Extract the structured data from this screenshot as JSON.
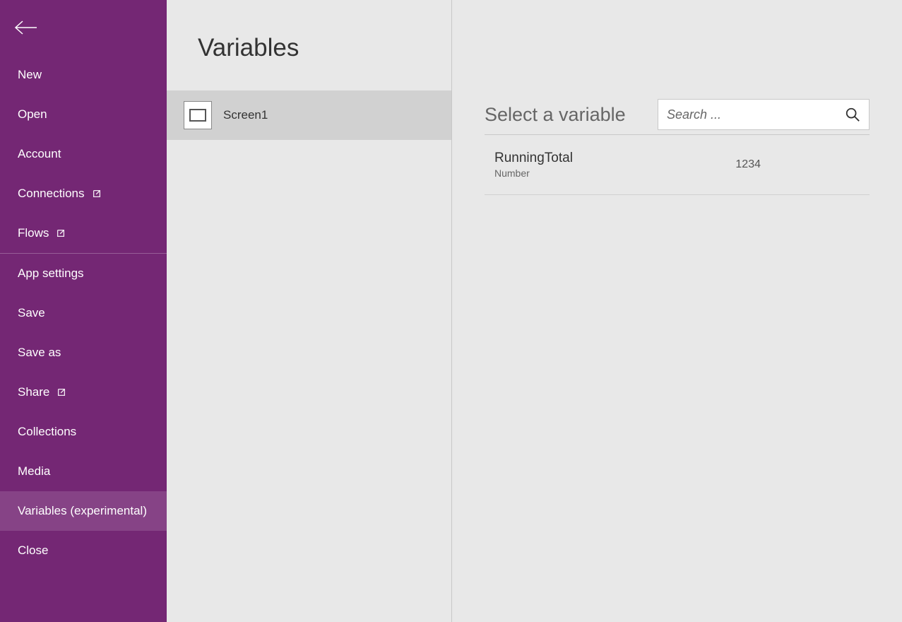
{
  "sidebar": {
    "items": [
      {
        "label": "New"
      },
      {
        "label": "Open"
      },
      {
        "label": "Account"
      },
      {
        "label": "Connections",
        "external": true
      },
      {
        "label": "Flows",
        "external": true
      },
      {
        "label": "App settings"
      },
      {
        "label": "Save"
      },
      {
        "label": "Save as"
      },
      {
        "label": "Share",
        "external": true
      },
      {
        "label": "Collections"
      },
      {
        "label": "Media"
      },
      {
        "label": "Variables (experimental)",
        "selected": true
      },
      {
        "label": "Close"
      }
    ]
  },
  "middle": {
    "title": "Variables",
    "screens": [
      {
        "label": "Screen1"
      }
    ]
  },
  "right": {
    "title": "Select a variable",
    "search_placeholder": "Search ...",
    "variables": [
      {
        "name": "RunningTotal",
        "type": "Number",
        "value": "1234"
      }
    ]
  }
}
